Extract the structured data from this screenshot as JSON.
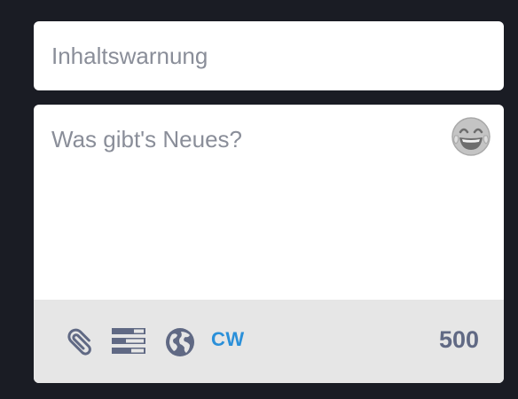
{
  "content_warning": {
    "placeholder": "Inhaltswarnung"
  },
  "compose": {
    "placeholder": "Was gibt's Neues?",
    "emoji_icon": "laughing-tears-emoji-icon"
  },
  "toolbar": {
    "attach_icon": "paperclip-icon",
    "poll_icon": "poll-icon",
    "visibility_icon": "globe-icon",
    "cw_label": "CW",
    "char_counter": "500"
  },
  "colors": {
    "background": "#1a1c24",
    "field": "#ffffff",
    "placeholder": "#8a8e99",
    "toolbar": "#e6e6e6",
    "icons": "#606984",
    "accent": "#2b90d9"
  }
}
